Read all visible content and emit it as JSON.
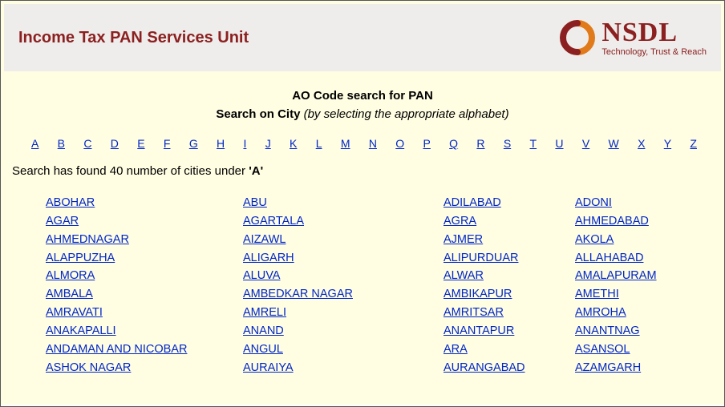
{
  "header": {
    "title": "Income Tax PAN Services Unit",
    "logo_main": "NSDL",
    "logo_sub": "Technology, Trust & Reach"
  },
  "page": {
    "ao_title": "AO Code search for PAN",
    "sub_bold": "Search on City",
    "sub_ital": "(by selecting the appropriate alphabet)",
    "result_prefix": "Search has found 40 number of cities under ",
    "result_letter": "'A'"
  },
  "alphabet": [
    "A",
    "B",
    "C",
    "D",
    "E",
    "F",
    "G",
    "H",
    "I",
    "J",
    "K",
    "L",
    "M",
    "N",
    "O",
    "P",
    "Q",
    "R",
    "S",
    "T",
    "U",
    "V",
    "W",
    "X",
    "Y",
    "Z"
  ],
  "cities": [
    [
      "ABOHAR",
      "ABU",
      "ADILABAD",
      "ADONI"
    ],
    [
      "AGAR",
      "AGARTALA",
      "AGRA",
      "AHMEDABAD"
    ],
    [
      "AHMEDNAGAR",
      "AIZAWL",
      "AJMER",
      "AKOLA"
    ],
    [
      "ALAPPUZHA",
      "ALIGARH",
      "ALIPURDUAR",
      "ALLAHABAD"
    ],
    [
      "ALMORA",
      "ALUVA",
      "ALWAR",
      "AMALAPURAM"
    ],
    [
      "AMBALA",
      "AMBEDKAR NAGAR",
      "AMBIKAPUR",
      "AMETHI"
    ],
    [
      "AMRAVATI",
      "AMRELI",
      "AMRITSAR",
      "AMROHA"
    ],
    [
      "ANAKAPALLI",
      "ANAND",
      "ANANTAPUR",
      "ANANTNAG"
    ],
    [
      "ANDAMAN AND NICOBAR",
      "ANGUL",
      "ARA",
      "ASANSOL"
    ],
    [
      "ASHOK NAGAR",
      "AURAIYA",
      "AURANGABAD",
      "AZAMGARH"
    ]
  ]
}
